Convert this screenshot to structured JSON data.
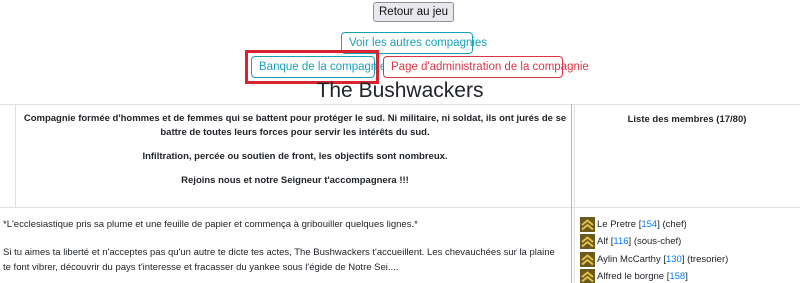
{
  "nav": {
    "back_label": "Retour au jeu",
    "others_label": "Voir les autres compagnies",
    "bank_label": "Banque de la compagnie",
    "admin_label": "Page d'administration de la compagnie"
  },
  "company": {
    "name": "The Bushwackers",
    "description": [
      "Compagnie formée d'hommes et de femmes qui se battent pour protéger le sud. Ni militaire, ni soldat, ils ont jurés de se battre de toutes leurs forces pour servir les intérêts du sud.",
      "Infiltration, percée ou soutien de front, les objectifs sont nombreux.",
      "Rejoins nous et notre Seigneur t'accompagnera !!!"
    ],
    "intro": [
      "*L'ecclesiastique pris sa plume et une feuille de papier et commença à gribouiller quelques lignes.*",
      "Si tu aimes ta liberté et n'acceptes pas qu'un autre te dicte tes actes, The Bushwackers t'accueillent. Les chevauchées sur la plaine te font vibrer, découvrir du pays t'interesse et fracasser du yankee sous l'égide de Notre Sei...."
    ]
  },
  "members": {
    "title": "Liste des membres (17/80)",
    "list": [
      {
        "name": "Le Pretre",
        "level": "154",
        "role": "(chef)",
        "icon": "rank-chevron-icon"
      },
      {
        "name": "Alf",
        "level": "116",
        "role": "(sous-chef)",
        "icon": "rank-chevron-icon"
      },
      {
        "name": "Aylin McCarthy",
        "level": "130",
        "role": "(tresorier)",
        "icon": "rank-chevron-icon"
      },
      {
        "name": "Alfred le borgne",
        "level": "158",
        "role": "",
        "icon": "rank-chevron-icon"
      }
    ]
  },
  "colors": {
    "info": "#17a2b8",
    "danger": "#dc3545",
    "highlight": "#d9232f",
    "link": "#007bff",
    "rank_gold": "#c9a227",
    "rank_bg": "#6b5a1e"
  }
}
